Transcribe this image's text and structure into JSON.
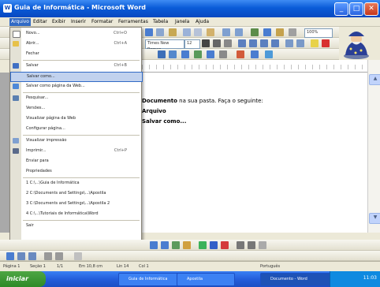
{
  "window": {
    "title": "Guia de Informática - Microsoft Word",
    "app_icon": "W",
    "minimize": "_",
    "maximize": "□",
    "close": "✕"
  },
  "menubar": {
    "items": [
      "Arquivo",
      "Editar",
      "Exibir",
      "Inserir",
      "Formatar",
      "Ferramentas",
      "Tabela",
      "Janela",
      "Ajuda"
    ]
  },
  "toolbar": {
    "zoom": "100%",
    "font_name": "Times New Roman",
    "font_size": "12"
  },
  "file_menu": {
    "items": [
      {
        "label": "Novo...",
        "shortcut": "Ctrl+O",
        "icon": "new-document-icon"
      },
      {
        "label": "Abrir...",
        "shortcut": "Ctrl+A",
        "icon": "open-folder-icon"
      },
      {
        "label": "Fechar",
        "shortcut": "",
        "icon": ""
      },
      {
        "label": "Salvar",
        "shortcut": "Ctrl+B",
        "icon": "save-icon"
      },
      {
        "label": "Salvar como...",
        "shortcut": "",
        "icon": ""
      },
      {
        "label": "Salvar como página da Web...",
        "shortcut": "",
        "icon": "web-page-icon"
      },
      {
        "label": "Pesquisar...",
        "shortcut": "",
        "icon": "search-icon"
      },
      {
        "label": "Versões...",
        "shortcut": "",
        "icon": ""
      },
      {
        "label": "Visualizar página da Web",
        "shortcut": "",
        "icon": ""
      },
      {
        "label": "Configurar página...",
        "shortcut": "",
        "icon": ""
      },
      {
        "label": "Visualizar impressão",
        "shortcut": "",
        "icon": "print-preview-icon"
      },
      {
        "label": "Imprimir...",
        "shortcut": "Ctrl+P",
        "icon": "print-icon"
      },
      {
        "label": "Enviar para",
        "shortcut": "",
        "icon": ""
      },
      {
        "label": "Propriedades",
        "shortcut": "",
        "icon": ""
      },
      {
        "label": "1 C:\\...\\Guia de Informática",
        "shortcut": "",
        "icon": ""
      },
      {
        "label": "2 C:\\Documents and Settings\\...\\Apostila",
        "shortcut": "",
        "icon": ""
      },
      {
        "label": "3 C:\\Documents and Settings\\...\\Apostila 2",
        "shortcut": "",
        "icon": ""
      },
      {
        "label": "4 C:\\...\\Tutoriais de Informática\\Word",
        "shortcut": "",
        "icon": ""
      },
      {
        "label": "Sair",
        "shortcut": "",
        "icon": ""
      }
    ],
    "highlighted_index": 4
  },
  "document": {
    "lines": [
      {
        "bold": "Documento",
        "text": " na sua pasta. Faça o seguinte:"
      },
      {
        "bold": "Arquivo",
        "text": ""
      },
      {
        "bold": "Salvar como...",
        "text": ""
      }
    ]
  },
  "statusbar": {
    "page": "Página 1",
    "section": "Seção 1",
    "pages": "1/1",
    "position": "Em 10,8 cm",
    "line": "Lin 14",
    "col": "Col 1",
    "language": "Português"
  },
  "taskbar": {
    "start": "iniciar",
    "tasks": [
      "Guia de Informática",
      "Apostila",
      "Documento - Word"
    ],
    "clock": "11:03"
  },
  "colors": {
    "accent": "#316ac5",
    "titlebar": "#0a5cd8",
    "taskbar": "#245edb"
  }
}
